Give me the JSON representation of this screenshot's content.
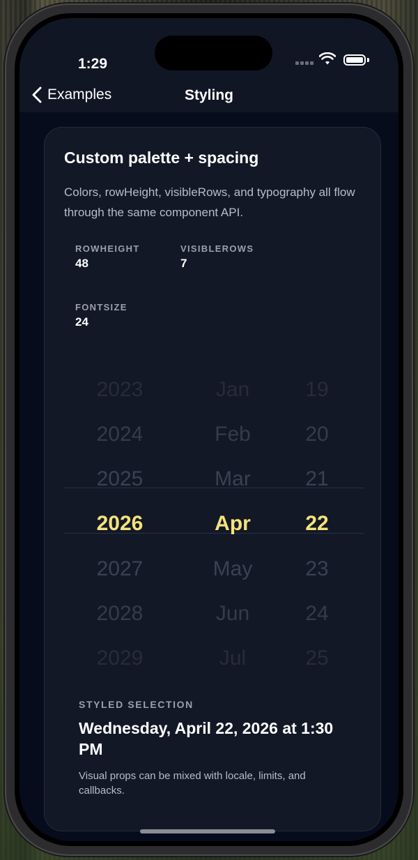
{
  "status_bar": {
    "time": "1:29"
  },
  "nav": {
    "back_label": "Examples",
    "title": "Styling"
  },
  "card": {
    "title": "Custom palette + spacing",
    "description": "Colors, rowHeight, visibleRows, and typography all flow through the same component API.",
    "stats": [
      {
        "label": "ROWHEIGHT",
        "value": "48"
      },
      {
        "label": "VISIBLEROWS",
        "value": "7"
      },
      {
        "label": "FONTSIZE",
        "value": "24"
      }
    ]
  },
  "picker": {
    "years": [
      "2023",
      "2024",
      "2025",
      "2026",
      "2027",
      "2028",
      "2029"
    ],
    "months": [
      "Jan",
      "Feb",
      "Mar",
      "Apr",
      "May",
      "Jun",
      "Jul"
    ],
    "days": [
      "19",
      "20",
      "21",
      "22",
      "23",
      "24",
      "25"
    ],
    "selected_index": 3,
    "selected_color": "#f5e27a"
  },
  "selection": {
    "label": "STYLED SELECTION",
    "value": "Wednesday, April 22, 2026 at 1:30 PM",
    "note": "Visual props can be mixed with locale, limits, and callbacks."
  },
  "icons": {
    "back": "chevron-left-icon",
    "wifi": "wifi-icon",
    "battery": "battery-icon",
    "signal": "cellular-signal-icon"
  }
}
